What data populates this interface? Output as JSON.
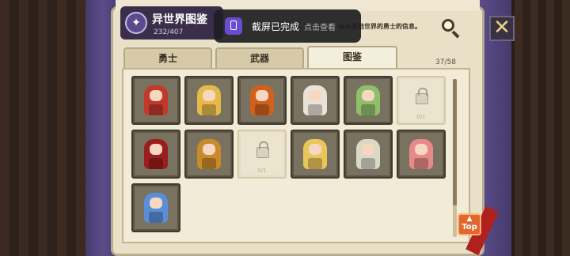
{
  "header": {
    "title": "异世界图鉴",
    "count": "232/407"
  },
  "toast": {
    "message": "截屏已完成",
    "action": "点击查看"
  },
  "description": "有从其他世界的勇士的信息。",
  "tabs": [
    {
      "label": "勇士",
      "active": false
    },
    {
      "label": "武器",
      "active": false
    },
    {
      "label": "图鉴",
      "active": true
    }
  ],
  "tab_count": "37/58",
  "close_label": "✕",
  "top_button": {
    "label": "Top",
    "arrow": "▲"
  },
  "cards": [
    {
      "kind": "hero",
      "color": "#c0392b"
    },
    {
      "kind": "hero",
      "color": "#e6b94a"
    },
    {
      "kind": "hero",
      "color": "#d0601e"
    },
    {
      "kind": "hero",
      "color": "#e9e2d6"
    },
    {
      "kind": "hero",
      "color": "#8fbf6a"
    },
    {
      "kind": "locked",
      "label": "0/1"
    },
    {
      "kind": "hero",
      "color": "#9b1d1d"
    },
    {
      "kind": "hero",
      "color": "#c98a2a"
    },
    {
      "kind": "locked",
      "label": "0/1"
    },
    {
      "kind": "hero",
      "color": "#e8c65a"
    },
    {
      "kind": "hero",
      "color": "#d9d9c8"
    },
    {
      "kind": "hero",
      "color": "#e88a8a"
    },
    {
      "kind": "hero",
      "color": "#5a8ed8"
    }
  ]
}
